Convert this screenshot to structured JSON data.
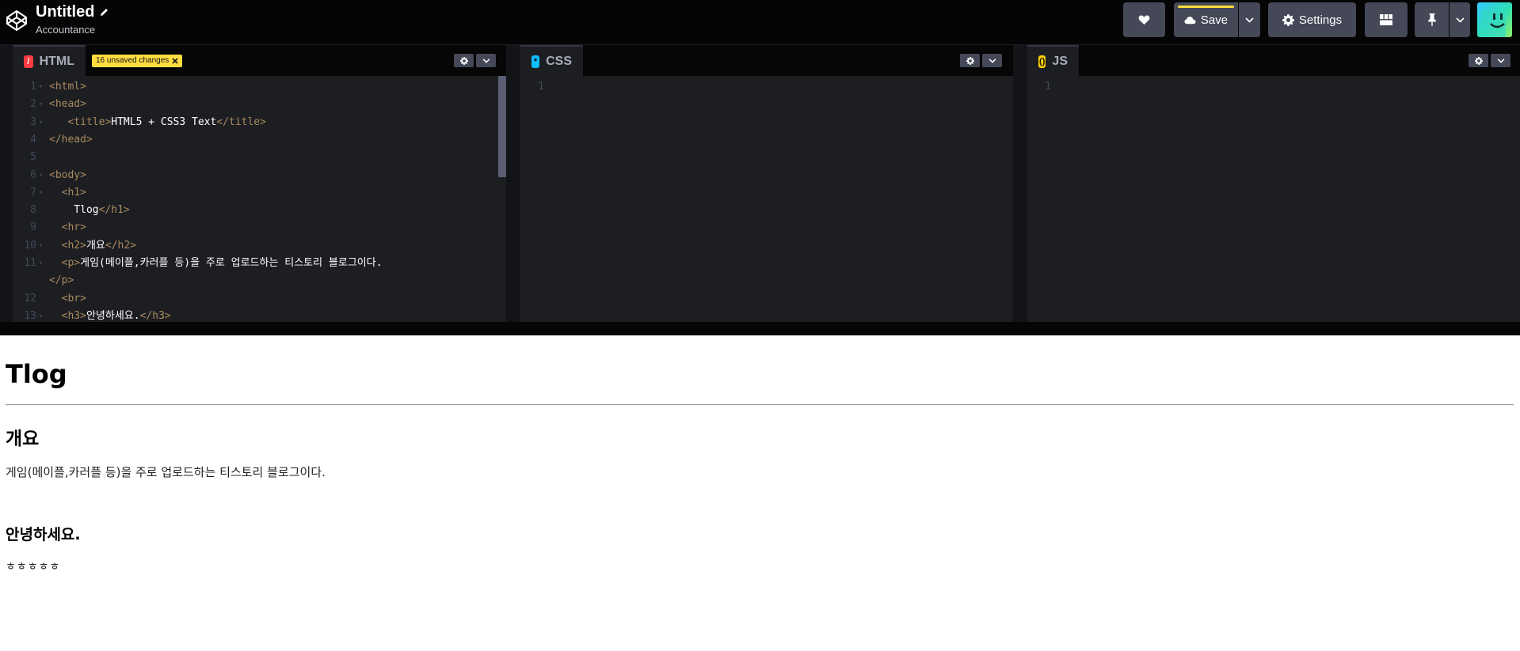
{
  "header": {
    "pen_title": "Untitled",
    "author": "Accountance",
    "save_label": "Save",
    "settings_label": "Settings"
  },
  "editors": [
    {
      "lang": "HTML",
      "badge": "/",
      "unsaved_label": "16 unsaved changes",
      "lines": [
        {
          "n": "1",
          "fold": true,
          "parts": [
            {
              "t": "tag",
              "v": "<html>"
            }
          ]
        },
        {
          "n": "2",
          "fold": true,
          "parts": [
            {
              "t": "tag",
              "v": "<head>"
            }
          ]
        },
        {
          "n": "3",
          "fold": true,
          "parts": [
            {
              "t": "txt",
              "v": "   "
            },
            {
              "t": "tag",
              "v": "<title>"
            },
            {
              "t": "txt",
              "v": "HTML5 + CSS3 Text"
            },
            {
              "t": "tag",
              "v": "</title>"
            }
          ]
        },
        {
          "n": "4",
          "fold": false,
          "parts": [
            {
              "t": "tag",
              "v": "</head>"
            }
          ]
        },
        {
          "n": "5",
          "fold": false,
          "parts": []
        },
        {
          "n": "6",
          "fold": true,
          "parts": [
            {
              "t": "tag",
              "v": "<body>"
            }
          ]
        },
        {
          "n": "7",
          "fold": true,
          "parts": [
            {
              "t": "txt",
              "v": "  "
            },
            {
              "t": "tag",
              "v": "<h1>"
            }
          ]
        },
        {
          "n": "8",
          "fold": false,
          "parts": [
            {
              "t": "txt",
              "v": "    Tlog"
            },
            {
              "t": "tag",
              "v": "</h1>"
            }
          ]
        },
        {
          "n": "9",
          "fold": false,
          "parts": [
            {
              "t": "txt",
              "v": "  "
            },
            {
              "t": "tag",
              "v": "<hr>"
            }
          ]
        },
        {
          "n": "10",
          "fold": true,
          "parts": [
            {
              "t": "txt",
              "v": "  "
            },
            {
              "t": "tag",
              "v": "<h2>"
            },
            {
              "t": "txt",
              "v": "개요"
            },
            {
              "t": "tag",
              "v": "</h2>"
            }
          ]
        },
        {
          "n": "11",
          "fold": true,
          "parts": [
            {
              "t": "txt",
              "v": "  "
            },
            {
              "t": "tag",
              "v": "<p>"
            },
            {
              "t": "txt",
              "v": "게임(메이플,카러플 등)을 주로 업로드하는 티스토리 블로그이다."
            }
          ]
        },
        {
          "n": "",
          "fold": false,
          "parts": [
            {
              "t": "tag",
              "v": "</p>"
            }
          ]
        },
        {
          "n": "12",
          "fold": false,
          "parts": [
            {
              "t": "txt",
              "v": "  "
            },
            {
              "t": "tag",
              "v": "<br>"
            }
          ]
        },
        {
          "n": "13",
          "fold": true,
          "parts": [
            {
              "t": "txt",
              "v": "  "
            },
            {
              "t": "tag",
              "v": "<h3>"
            },
            {
              "t": "txt",
              "v": "안녕하세요."
            },
            {
              "t": "tag",
              "v": "</h3>"
            }
          ]
        }
      ]
    },
    {
      "lang": "CSS",
      "badge": "*",
      "lines": [
        {
          "n": "1",
          "fold": false,
          "parts": []
        }
      ]
    },
    {
      "lang": "JS",
      "badge": "()",
      "lines": [
        {
          "n": "1",
          "fold": false,
          "parts": []
        }
      ]
    }
  ],
  "preview": {
    "h1": "Tlog",
    "h2": "개요",
    "paragraph": "게임(메이플,카러플 등)을 주로 업로드하는 티스토리 블로그이다.",
    "h3": "안녕하세요.",
    "trailing_text": "ㅎㅎㅎㅎㅎ"
  },
  "colors": {
    "header_bg": "#050505",
    "button_bg": "#444857",
    "save_accent": "#ffdd40",
    "html_badge": "#ff3c41",
    "css_badge": "#0ebeff",
    "js_badge": "#fcd000",
    "editor_bg": "#1d1e22",
    "tag_color": "#a88a5f"
  }
}
